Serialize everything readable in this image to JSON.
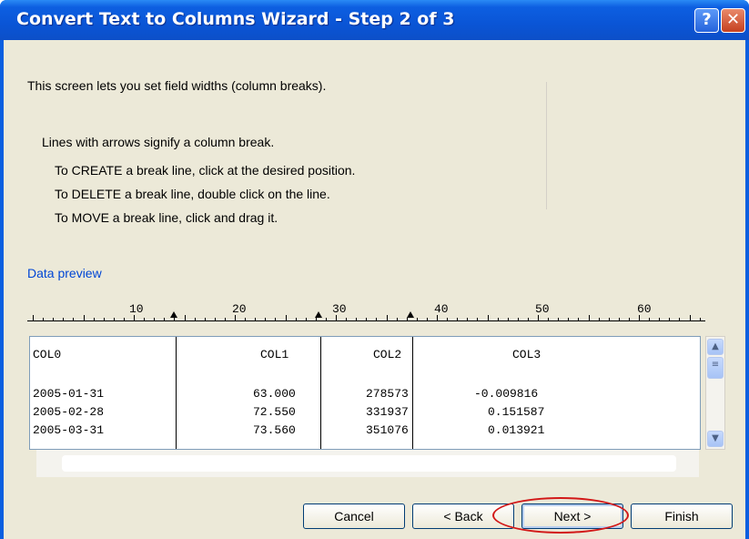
{
  "window": {
    "title": "Convert Text to Columns Wizard - Step 2 of 3",
    "help_glyph": "?",
    "close_glyph": "✕"
  },
  "intro": "This screen lets you set field widths (column breaks).",
  "instructions": {
    "heading": "Lines with arrows signify a column break.",
    "create": "To CREATE a break line, click at the desired position.",
    "delete": "To DELETE a break line, double click on the line.",
    "move": "To MOVE a break line, click and drag it."
  },
  "preview": {
    "label": "Data preview",
    "ruler_numbers": [
      "10",
      "20",
      "30",
      "40",
      "50",
      "60"
    ],
    "header": [
      "COL0",
      "COL1",
      "COL2",
      "COL3"
    ],
    "rows": [
      [
        "2005-01-31",
        "63.000",
        "278573",
        "-0.009816"
      ],
      [
        "2005-02-28",
        "72.550",
        "331937",
        "0.151587"
      ],
      [
        "2005-03-31",
        "73.560",
        "351076",
        "0.013921"
      ]
    ]
  },
  "buttons": {
    "cancel": "Cancel",
    "back": "< Back",
    "next": "Next >",
    "finish": "Finish"
  },
  "colors": {
    "title_bar": "#0a55d6",
    "dialog_bg": "#ece9d8",
    "link_blue": "#0046d5",
    "highlight_red": "#d21818"
  },
  "icons": {
    "help": "help-icon",
    "close": "close-icon",
    "scroll_up": "arrow-up-icon",
    "scroll_down": "arrow-down-icon"
  }
}
